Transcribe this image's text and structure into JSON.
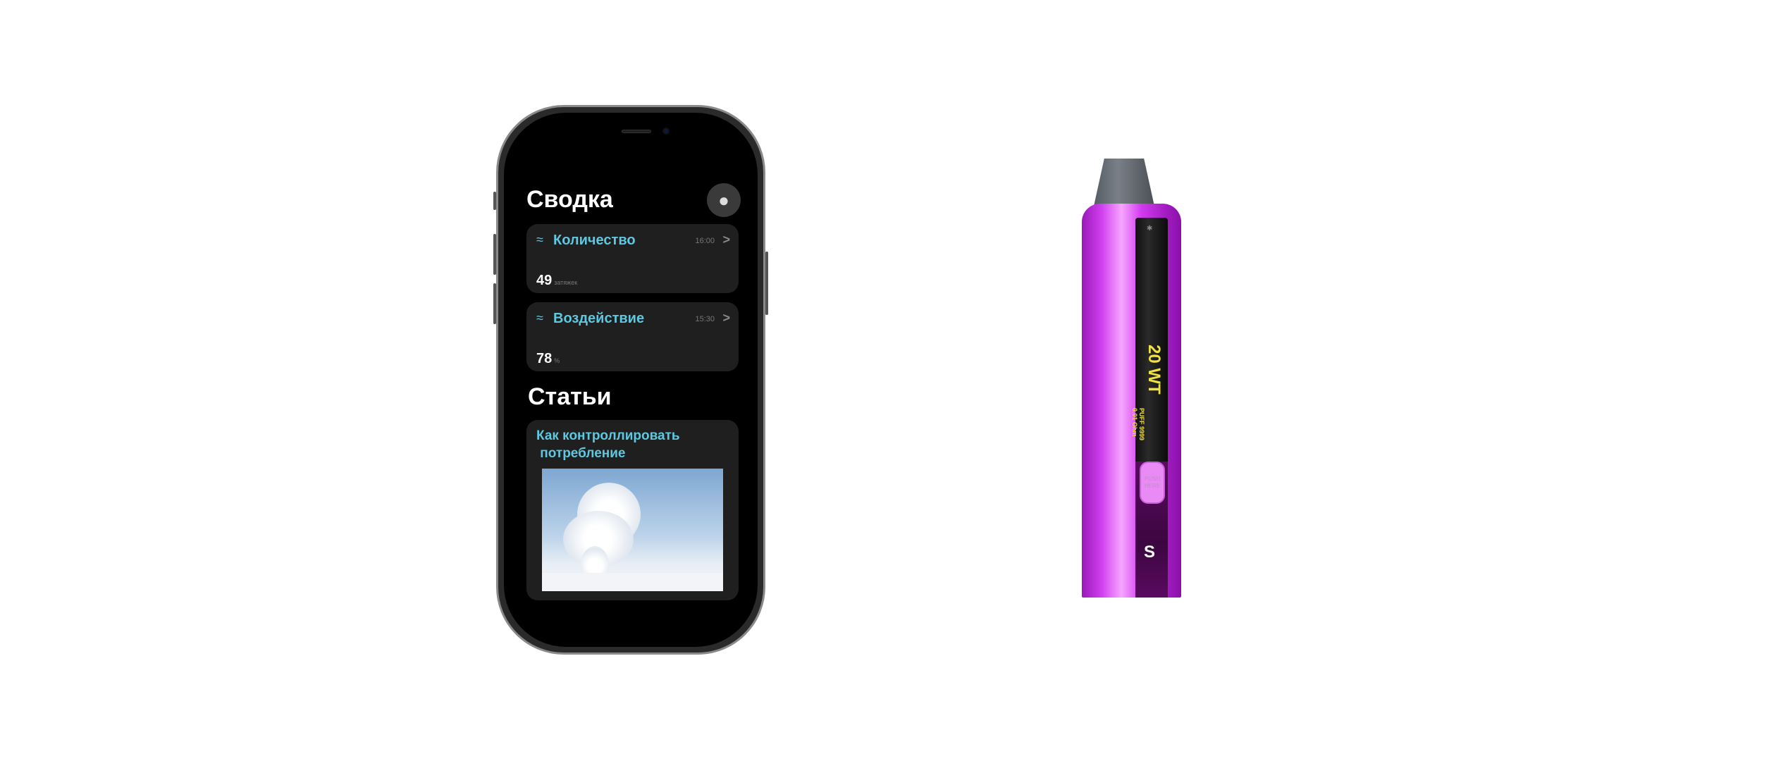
{
  "summary": {
    "title": "Сводка",
    "cards": [
      {
        "title": "Количество",
        "time": "16:00",
        "value": "49",
        "unit": "затяжек"
      },
      {
        "title": "Воздействие",
        "time": "15:30",
        "value": "78",
        "unit": "%"
      }
    ]
  },
  "articles": {
    "title": "Статьи",
    "items": [
      {
        "title": "Как контроллировать\n потребление"
      }
    ]
  },
  "device": {
    "power": "20 WT",
    "puff": "PUFF 9999",
    "resistance": "0.01 Ohm",
    "button": "PUSH HERE"
  },
  "colors": {
    "accent": "#5ec8e0",
    "device_body": "#d040f0",
    "display_text": "#f0e040"
  }
}
